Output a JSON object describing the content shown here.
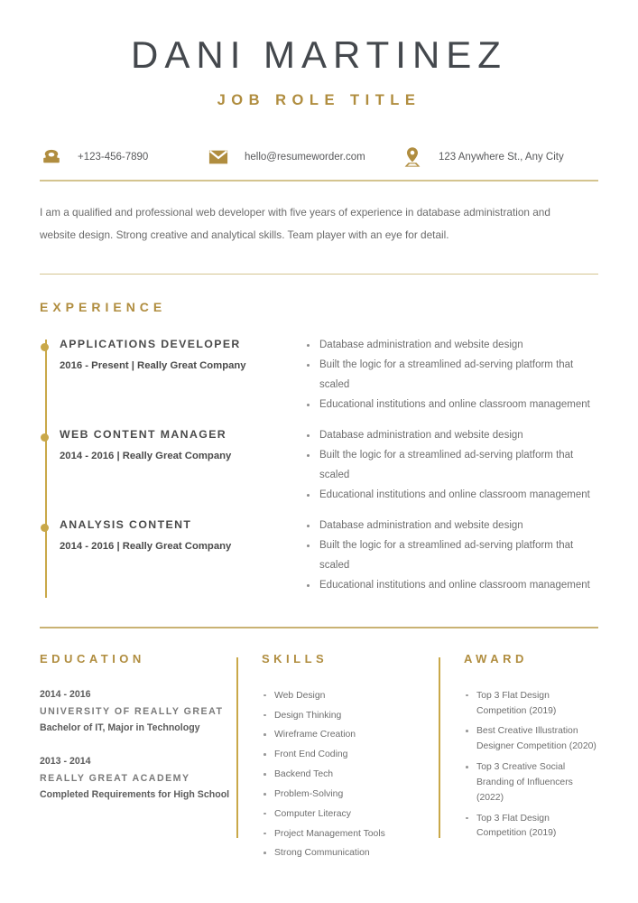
{
  "header": {
    "name": "DANI MARTINEZ",
    "job_title": "JOB ROLE TITLE"
  },
  "colors": {
    "accent_gold": "#b08d3f",
    "rule_gold": "#d4c48f",
    "timeline_gold": "#c9a849",
    "name_gray": "#44484d",
    "body_gray": "#6b6b6b"
  },
  "contact": {
    "phone": {
      "icon": "phone-icon",
      "text": "+123-456-7890"
    },
    "email": {
      "icon": "envelope-icon",
      "text": "hello@resumeworder.com"
    },
    "address": {
      "icon": "location-pin-icon",
      "text": "123 Anywhere St., Any City"
    }
  },
  "summary": {
    "text": "I am a qualified and professional web developer with five years of experience in database administration and website design. Strong creative and analytical skills. Team player with an eye for detail."
  },
  "experience": {
    "heading": "EXPERIENCE",
    "entries": [
      {
        "role": "APPLICATIONS DEVELOPER",
        "meta": "2016 - Present | Really Great Company",
        "bullets": [
          "Database administration and website design",
          "Built the logic for a streamlined ad-serving platform that scaled",
          "Educational institutions and online classroom management"
        ]
      },
      {
        "role": "WEB CONTENT MANAGER",
        "meta": "2014 - 2016 | Really Great Company",
        "bullets": [
          "Database administration and website design",
          "Built the logic for a streamlined ad-serving platform that scaled",
          "Educational institutions and online classroom management"
        ]
      },
      {
        "role": "ANALYSIS CONTENT",
        "meta": "2014 - 2016 | Really Great Company",
        "bullets": [
          "Database administration and website design",
          "Built the logic for a streamlined ad-serving platform that scaled",
          "Educational institutions and online classroom management"
        ]
      }
    ]
  },
  "education": {
    "heading": "EDUCATION",
    "entries": [
      {
        "dates": "2014 - 2016",
        "school": "UNIVERSITY OF REALLY GREAT",
        "degree": "Bachelor of IT, Major in Technology"
      },
      {
        "dates": "2013 - 2014",
        "school": "REALLY GREAT ACADEMY",
        "degree": "Completed Requirements for High School"
      }
    ]
  },
  "skills": {
    "heading": "SKILLS",
    "items": [
      "Web Design",
      "Design Thinking",
      "Wireframe Creation",
      "Front End Coding",
      "Backend Tech",
      "Problem-Solving",
      "Computer Literacy",
      "Project Management Tools",
      "Strong Communication"
    ]
  },
  "award": {
    "heading": "AWARD",
    "items": [
      "Top 3 Flat Design Competition (2019)",
      "Best Creative Illustration Designer Competition (2020)",
      "Top 3 Creative Social Branding of Influencers (2022)",
      "Top 3 Flat Design Competition (2019)"
    ]
  }
}
